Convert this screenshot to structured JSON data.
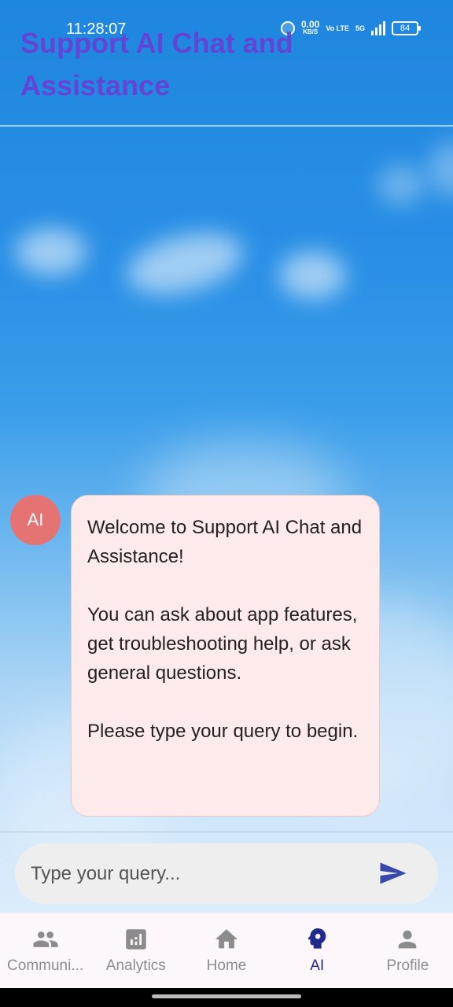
{
  "status_bar": {
    "time": "11:28:07",
    "net_speed": "0.00",
    "net_unit": "KB/S",
    "volte": "Vo LTE",
    "network": "5G",
    "battery": "84"
  },
  "app_bar": {
    "title": "Support AI Chat and Assistance",
    "title_color": "#6a3fd4"
  },
  "chat": {
    "messages": [
      {
        "sender_avatar": "AI",
        "avatar_color": "#e57373",
        "bubble_color": "#fdeaea",
        "text": "Welcome to Support AI Chat and Assistance!\n\nYou can ask about app features, get troubleshooting help, or ask general questions.\n\nPlease type your query to begin."
      }
    ]
  },
  "composer": {
    "placeholder": "Type your query...",
    "send_icon": "send-icon",
    "send_color": "#3949ab"
  },
  "bottom_nav": {
    "items": [
      {
        "label": "Communi...",
        "icon": "people-icon",
        "active": false
      },
      {
        "label": "Analytics",
        "icon": "analytics-icon",
        "active": false
      },
      {
        "label": "Home",
        "icon": "home-icon",
        "active": false
      },
      {
        "label": "AI",
        "icon": "ai-head-icon",
        "active": true
      },
      {
        "label": "Profile",
        "icon": "person-icon",
        "active": false
      }
    ],
    "active_color": "#1f2a8c",
    "inactive_color": "#8c8c8c"
  }
}
